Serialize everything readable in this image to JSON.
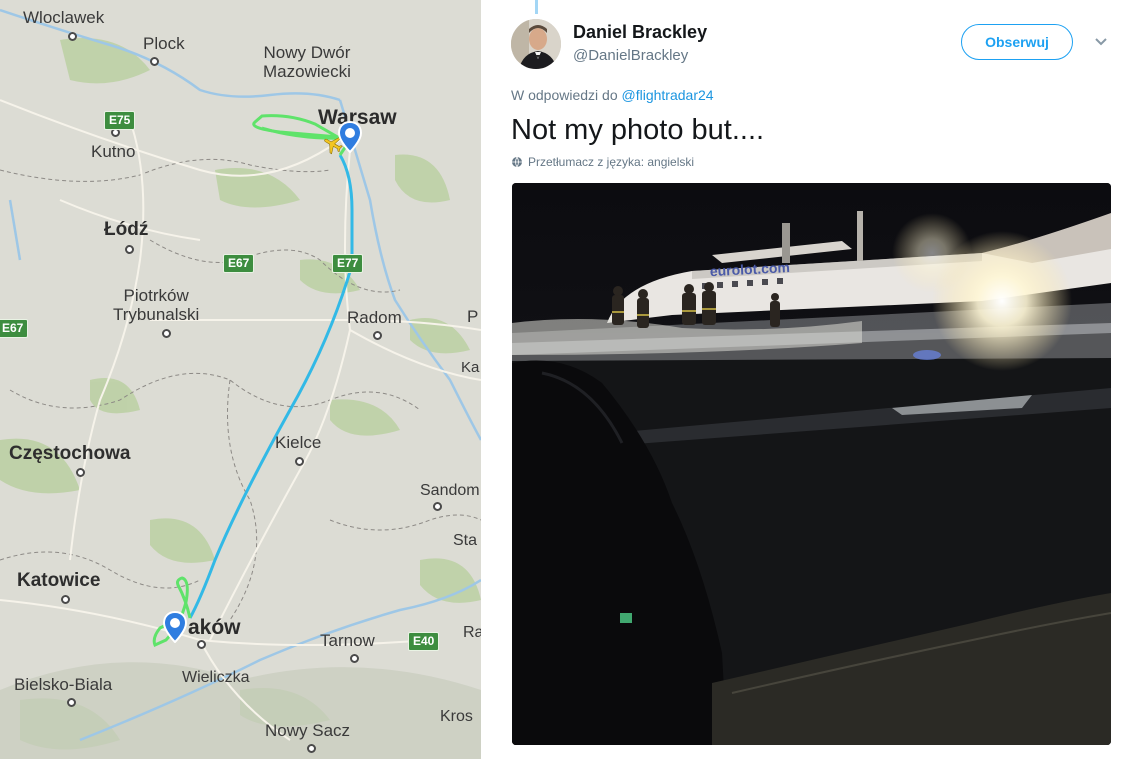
{
  "map": {
    "cities": {
      "wloclawek": "Wloclawek",
      "plock": "Plock",
      "nowy_dwor": "Nowy Dwór\nMazowiecki",
      "warsaw": "Warsaw",
      "kutno": "Kutno",
      "lodz": "Łódź",
      "piotrkow": "Piotrków\nTrybunalski",
      "radom": "Radom",
      "czestochowa": "Częstochowa",
      "kielce": "Kielce",
      "sandomierz": "Sandom",
      "sta": "Sta",
      "katowice": "Katowice",
      "krakow": "aków",
      "tarnow": "Tarnow",
      "ra": "Ra",
      "bielsko": "Bielsko-Biala",
      "wieliczka": "Wieliczka",
      "nowy_sacz": "Nowy Sacz",
      "krosno": "Kros",
      "p_edge": "P",
      "ka_edge": "Ka"
    },
    "roads": {
      "e75": "E75",
      "e67_center": "E67",
      "e77": "E77",
      "e67_left": "E67",
      "e40": "E40"
    },
    "colors": {
      "track_green": "#5fe36a",
      "track_blue": "#32b9e6",
      "pin": "#2f7de0"
    },
    "icons": [
      "airplane-icon",
      "location-pin-icon"
    ]
  },
  "tweet": {
    "name": "Daniel Brackley",
    "handle": "@DanielBrackley",
    "follow_label": "Obserwuj",
    "reply_prefix": "W odpowiedzi do ",
    "reply_to": "@flightradar24",
    "text": "Not my photo but....",
    "translate": "Przetłumacz z języka: angielski",
    "photo_caption": "eurolot.com",
    "accent": "#1da1f2"
  }
}
